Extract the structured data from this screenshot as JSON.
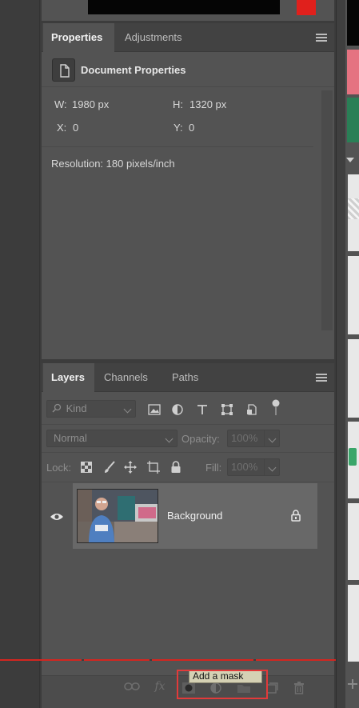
{
  "properties_panel": {
    "tabs": [
      "Properties",
      "Adjustments"
    ],
    "header_title": "Document Properties",
    "width_label": "W:",
    "width_value": "1980 px",
    "height_label": "H:",
    "height_value": "1320 px",
    "x_label": "X:",
    "x_value": "0",
    "y_label": "Y:",
    "y_value": "0",
    "resolution": "Resolution: 180 pixels/inch"
  },
  "layers_panel": {
    "tabs": [
      "Layers",
      "Channels",
      "Paths"
    ],
    "filter_kind": "Kind",
    "blend_mode": "Normal",
    "opacity_label": "Opacity:",
    "opacity_value": "100%",
    "lock_label": "Lock:",
    "fill_label": "Fill:",
    "fill_value": "100%",
    "layers": [
      {
        "name": "Background",
        "visible": true,
        "locked": true
      }
    ]
  },
  "tooltip": "Add a mask",
  "colors": {
    "accent_red": "#e0201c",
    "swatch_pink": "#e57381",
    "swatch_green": "#2a7f56",
    "highlight_box": "#e23a3a"
  }
}
